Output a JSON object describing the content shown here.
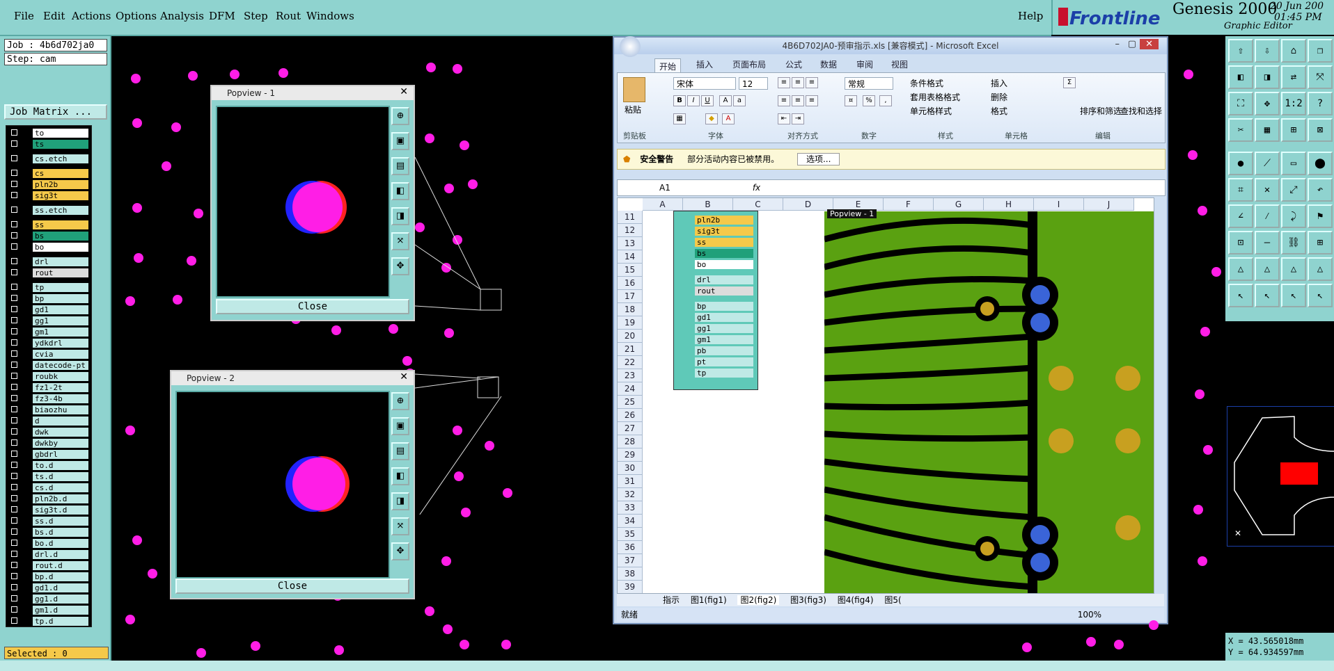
{
  "menubar": {
    "items": [
      "File",
      "Edit",
      "Actions",
      "Options",
      "Analysis",
      "DFM",
      "Step",
      "Rout",
      "Windows"
    ],
    "help": "Help"
  },
  "brand": {
    "logo": "Frontline",
    "product": "Genesis 2000",
    "subtitle": "Graphic Editor",
    "date": "20 Jun 200",
    "time": "01:45 PM"
  },
  "left": {
    "job": "Job : 4b6d702ja0",
    "step": "Step: cam",
    "job_matrix": "Job Matrix ...",
    "selected": "Selected : 0",
    "layers": [
      {
        "name": "to",
        "color": "#ffffff"
      },
      {
        "name": "ts",
        "color": "#20a07a"
      },
      {
        "name": "cs.etch",
        "color": "#bfe9e6"
      },
      {
        "name": "cs",
        "color": "#f5c94a"
      },
      {
        "name": "pln2b",
        "color": "#f5c94a"
      },
      {
        "name": "sig3t",
        "color": "#f5c94a"
      },
      {
        "name": "ss.etch",
        "color": "#bfe9e6"
      },
      {
        "name": "ss",
        "color": "#f5c94a"
      },
      {
        "name": "bs",
        "color": "#20a07a"
      },
      {
        "name": "bo",
        "color": "#ffffff"
      },
      {
        "name": "drl",
        "color": "#bfe9e6"
      },
      {
        "name": "rout",
        "color": "#dcdcdc"
      },
      {
        "name": "tp",
        "color": "#bfe9e6"
      },
      {
        "name": "bp",
        "color": "#bfe9e6"
      },
      {
        "name": "gd1",
        "color": "#bfe9e6"
      },
      {
        "name": "gg1",
        "color": "#bfe9e6"
      },
      {
        "name": "gm1",
        "color": "#bfe9e6"
      },
      {
        "name": "ydkdrl",
        "color": "#bfe9e6"
      },
      {
        "name": "cvia",
        "color": "#bfe9e6"
      },
      {
        "name": "datecode-pt",
        "color": "#bfe9e6"
      },
      {
        "name": "roubk",
        "color": "#bfe9e6"
      },
      {
        "name": "fz1-2t",
        "color": "#bfe9e6"
      },
      {
        "name": "fz3-4b",
        "color": "#bfe9e6"
      },
      {
        "name": "biaozhu",
        "color": "#bfe9e6"
      },
      {
        "name": "d",
        "color": "#bfe9e6"
      },
      {
        "name": "dwk",
        "color": "#bfe9e6"
      },
      {
        "name": "dwkby",
        "color": "#bfe9e6"
      },
      {
        "name": "gbdrl",
        "color": "#bfe9e6"
      },
      {
        "name": "to.d",
        "color": "#bfe9e6"
      },
      {
        "name": "ts.d",
        "color": "#bfe9e6"
      },
      {
        "name": "cs.d",
        "color": "#bfe9e6"
      },
      {
        "name": "pln2b.d",
        "color": "#bfe9e6"
      },
      {
        "name": "sig3t.d",
        "color": "#bfe9e6"
      },
      {
        "name": "ss.d",
        "color": "#bfe9e6"
      },
      {
        "name": "bs.d",
        "color": "#bfe9e6"
      },
      {
        "name": "bo.d",
        "color": "#bfe9e6"
      },
      {
        "name": "drl.d",
        "color": "#bfe9e6"
      },
      {
        "name": "rout.d",
        "color": "#bfe9e6"
      },
      {
        "name": "bp.d",
        "color": "#bfe9e6"
      },
      {
        "name": "gd1.d",
        "color": "#bfe9e6"
      },
      {
        "name": "gg1.d",
        "color": "#bfe9e6"
      },
      {
        "name": "gm1.d",
        "color": "#bfe9e6"
      },
      {
        "name": "tp.d",
        "color": "#bfe9e6"
      }
    ]
  },
  "popview1": {
    "title": "Popview - 1",
    "close": "Close"
  },
  "popview2": {
    "title": "Popview - 2",
    "close": "Close"
  },
  "excel": {
    "title": "4B6D702JA0-预审指示.xls [兼容模式] - Microsoft Excel",
    "tabs": [
      "开始",
      "插入",
      "页面布局",
      "公式",
      "数据",
      "审阅",
      "视图"
    ],
    "font_name": "宋体",
    "font_size": "12",
    "number_format": "常规",
    "paste": "粘贴",
    "groups": [
      "剪贴板",
      "字体",
      "对齐方式",
      "数字",
      "样式",
      "单元格",
      "编辑"
    ],
    "style_buttons": [
      "条件格式",
      "套用表格格式",
      "单元格样式"
    ],
    "cell_buttons": [
      "插入",
      "删除",
      "格式"
    ],
    "edit_buttons": [
      "排序和筛选",
      "查找和选择"
    ],
    "warn_title": "安全警告",
    "warn_text": "部分活动内容已被禁用。",
    "warn_button": "选项...",
    "name_box": "A1",
    "fx": "fx",
    "columns": [
      "A",
      "B",
      "C",
      "D",
      "E",
      "F",
      "G",
      "H",
      "I",
      "J"
    ],
    "rows": [
      "11",
      "12",
      "13",
      "14",
      "15",
      "16",
      "17",
      "18",
      "19",
      "20",
      "21",
      "22",
      "23",
      "24",
      "25",
      "26",
      "27",
      "28",
      "29",
      "30",
      "31",
      "32",
      "33",
      "34",
      "35",
      "36",
      "37",
      "38",
      "39"
    ],
    "embedded_layers": [
      "pln2b",
      "sig3t",
      "ss",
      "bs",
      "bo",
      "drl",
      "rout",
      "bp",
      "gd1",
      "gg1",
      "gm1",
      "pb",
      "pt",
      "tp"
    ],
    "embedded_popview": "Popview - 1",
    "sheets": [
      "指示",
      "图1(fig1)",
      "图2(fig2)",
      "图3(fig3)",
      "图4(fig4)",
      "图5("
    ],
    "status": "就绪",
    "zoom": "100%"
  },
  "coords": {
    "x": "X = 43.565018mm",
    "y": "Y = 64.934597mm"
  }
}
